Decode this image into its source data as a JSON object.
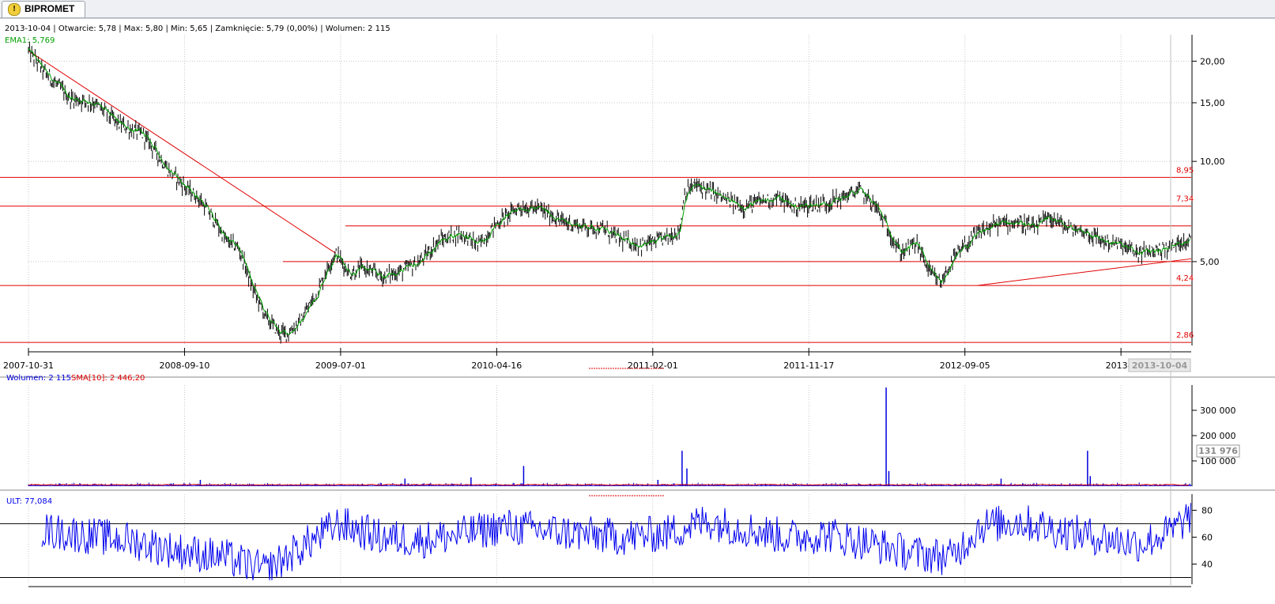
{
  "tab": {
    "icon": "alert-icon",
    "title": "BIPROMET"
  },
  "colors": {
    "grid": "#c8c8c8",
    "price": "#000000",
    "ema": "#00a000",
    "support": "#e00000",
    "volume": "#0000dd",
    "sma": "#e00000",
    "ult": "#0000ee",
    "ult_bands": "#000000"
  },
  "info": {
    "line": "2013-10-04 | Otwarcie: 5,78 | Max: 5,80 | Min: 5,65 | Zamknięcie: 5,79 (0,00%) | Wolumen: 2 115",
    "ema": "EMA1: 5,769"
  },
  "volume_legend": {
    "wolumen": "Wolumen: 2 115",
    "sma": "SMA[10]: 2 446,20"
  },
  "ult_legend": "ULT: 77,084",
  "x_dates": [
    "2007-10-31",
    "2008-09-10",
    "2009-07-01",
    "2010-04-16",
    "2011-02-01",
    "2011-11-17",
    "2012-09-05",
    "2013-0"
  ],
  "cursor_date": "2013-10-04",
  "cursor_volume": "131 976",
  "chart_data": [
    {
      "type": "line",
      "title": "BIPROMET",
      "scale": "log",
      "y_ticks": [
        "20,00",
        "15,00",
        "10,00",
        "5,00"
      ],
      "y_tick_values": [
        20,
        15,
        10,
        5
      ],
      "ylim": [
        2.8,
        24
      ],
      "x_range": [
        "2007-10-31",
        "2013-10-04"
      ],
      "series": [
        {
          "name": "",
          "x": [
            "2007-10-31",
            "2007-11-30",
            "2008-01-15",
            "2008-03-01",
            "2008-04-15",
            "2008-06-01",
            "2008-07-15",
            "2008-08-20",
            "2008-09-10",
            "2008-10-15",
            "2008-11-01",
            "2008-11-25",
            "2008-12-20",
            "2009-01-15",
            "2009-02-10",
            "2009-02-25",
            "2009-03-20",
            "2009-04-20",
            "2009-05-10",
            "2009-05-25",
            "2009-06-20",
            "2009-07-15",
            "2009-08-20",
            "2009-09-25",
            "2009-10-30",
            "2009-12-05",
            "2010-01-10",
            "2010-02-15",
            "2010-03-20",
            "2010-05-01",
            "2010-06-10",
            "2010-07-20",
            "2010-08-25",
            "2010-10-01",
            "2010-11-10",
            "2010-12-15",
            "2011-01-20",
            "2011-02-25",
            "2011-03-05",
            "2011-03-25",
            "2011-04-25",
            "2011-05-25",
            "2011-06-25",
            "2011-07-25",
            "2011-08-25",
            "2011-09-25",
            "2011-10-25",
            "2011-11-25",
            "2011-12-25",
            "2012-01-25",
            "2012-02-25",
            "2012-03-15",
            "2012-04-10",
            "2012-05-10",
            "2012-06-05",
            "2012-06-25",
            "2012-07-15",
            "2012-08-15",
            "2012-09-10",
            "2012-10-10",
            "2012-11-15",
            "2012-12-15",
            "2013-01-15",
            "2013-02-15",
            "2013-03-15",
            "2013-04-20",
            "2013-05-25",
            "2013-06-25",
            "2013-07-25",
            "2013-08-25",
            "2013-09-20",
            "2013-10-04"
          ],
          "y": [
            21.5,
            18.5,
            15.5,
            15.0,
            13.0,
            12.0,
            9.5,
            8.3,
            7.8,
            6.5,
            5.8,
            5.5,
            4.2,
            3.4,
            3.05,
            3.05,
            3.3,
            4.0,
            4.8,
            5.3,
            4.6,
            4.8,
            4.5,
            4.7,
            5.0,
            5.8,
            6.1,
            5.6,
            6.5,
            7.3,
            7.2,
            6.6,
            6.4,
            6.3,
            5.8,
            5.6,
            5.8,
            6.2,
            8.0,
            8.5,
            8.1,
            7.6,
            7.3,
            7.6,
            7.8,
            7.3,
            7.4,
            7.5,
            7.8,
            8.2,
            7.3,
            6.4,
            5.3,
            5.7,
            4.6,
            4.3,
            5.0,
            5.7,
            6.2,
            6.5,
            6.6,
            6.3,
            6.8,
            6.3,
            6.2,
            5.8,
            5.6,
            5.3,
            5.4,
            5.5,
            5.8,
            5.79
          ]
        },
        {
          "name": "EMA1",
          "x": [],
          "y": []
        }
      ],
      "levels": [
        8.95,
        7.34,
        6.4,
        5.0,
        4.24,
        2.86
      ],
      "level_labels": [
        "8,95",
        "7,34",
        "",
        "",
        "4,24",
        "2,86"
      ],
      "trendlines": [
        {
          "from": [
            "2007-10-31",
            21.5
          ],
          "to": [
            "2009-05-25",
            5.3
          ]
        },
        {
          "from": [
            "2012-09-01",
            4.24
          ],
          "to": [
            "2013-10-04",
            5.1
          ]
        }
      ]
    },
    {
      "type": "bar",
      "title": "Wolumen",
      "y_ticks": [
        "300 000",
        "200 000",
        "100 000"
      ],
      "y_tick_values": [
        300000,
        200000,
        100000
      ],
      "ylim": [
        0,
        400000
      ],
      "spikes": [
        {
          "x": "2008-09-15",
          "value": 25000
        },
        {
          "x": "2009-10-01",
          "value": 30000
        },
        {
          "x": "2010-02-01",
          "value": 35000
        },
        {
          "x": "2010-05-10",
          "value": 80000
        },
        {
          "x": "2011-01-15",
          "value": 25000
        },
        {
          "x": "2011-03-01",
          "value": 140000
        },
        {
          "x": "2011-03-10",
          "value": 70000
        },
        {
          "x": "2012-03-15",
          "value": 390000
        },
        {
          "x": "2012-03-20",
          "value": 60000
        },
        {
          "x": "2012-10-15",
          "value": 30000
        },
        {
          "x": "2013-03-25",
          "value": 140000
        },
        {
          "x": "2013-03-30",
          "value": 40000
        },
        {
          "x": "2013-10-04",
          "value": 2115
        }
      ],
      "series": [
        {
          "name": "SMA[10]",
          "values": [
            2446.2
          ]
        }
      ]
    },
    {
      "type": "line",
      "title": "ULT",
      "y_ticks": [
        "80",
        "60",
        "40"
      ],
      "y_tick_values": [
        80,
        60,
        40
      ],
      "ylim": [
        25,
        92
      ],
      "bands": [
        70,
        30
      ],
      "series": [
        {
          "name": "ULT",
          "x": [
            "2007-11-25",
            "2008-02-01",
            "2008-05-01",
            "2008-08-01",
            "2008-11-01",
            "2009-01-15",
            "2009-04-01",
            "2009-06-01",
            "2009-08-15",
            "2009-11-01",
            "2010-01-15",
            "2010-04-01",
            "2010-06-15",
            "2010-09-01",
            "2010-11-15",
            "2011-02-01",
            "2011-04-15",
            "2011-07-01",
            "2011-09-15",
            "2011-12-01",
            "2012-02-15",
            "2012-05-01",
            "2012-07-15",
            "2012-09-05",
            "2012-11-15",
            "2013-02-01",
            "2013-04-15",
            "2013-07-01",
            "2013-09-01",
            "2013-10-04"
          ],
          "y": [
            65,
            62,
            58,
            50,
            45,
            35,
            55,
            70,
            60,
            58,
            62,
            68,
            65,
            62,
            60,
            63,
            72,
            66,
            60,
            62,
            55,
            48,
            45,
            68,
            72,
            65,
            60,
            55,
            65,
            77
          ]
        }
      ]
    }
  ]
}
